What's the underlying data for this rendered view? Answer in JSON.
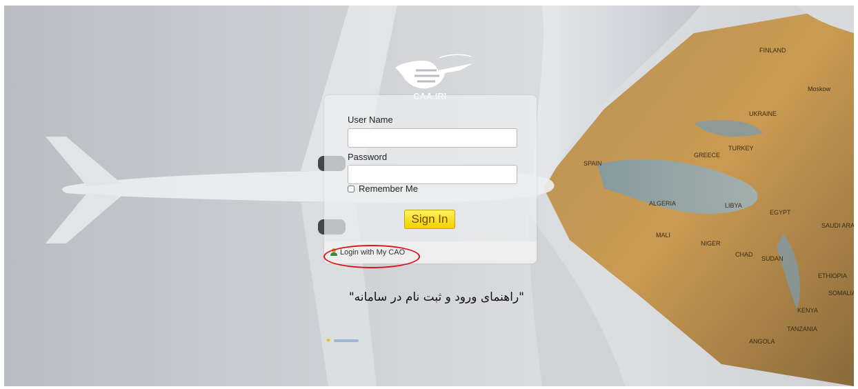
{
  "logo": {
    "text": "CAA.IRI"
  },
  "login": {
    "username_label": "User Name",
    "username_value": "",
    "password_label": "Password",
    "password_value": "",
    "remember_label": "Remember Me",
    "signin_label": "Sign In",
    "mycao_label": "Login with My CAO"
  },
  "guide_link": "\"راهنمای ورود و ثبت نام در سامانه\"",
  "map_labels": [
    "Moskow",
    "FINLAND",
    "ALGERIA",
    "LIBYA",
    "EGYPT",
    "SAUDI ARABIA",
    "SUDAN",
    "CHAD",
    "NIGER",
    "MALI",
    "SPAIN",
    "GREECE",
    "UKRAINE",
    "TURKEY",
    "ETHIOPIA",
    "SOMALIA",
    "KENYA",
    "TANZANIA",
    "ANGOLA"
  ],
  "colors": {
    "signin_bg": "#f5cf00",
    "oval": "#d9121c",
    "map": "#c89d57"
  }
}
